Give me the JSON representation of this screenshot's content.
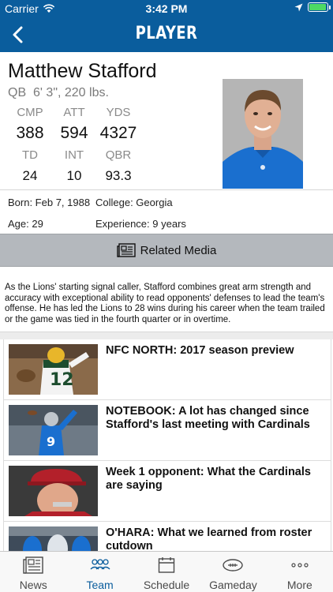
{
  "status": {
    "carrier": "Carrier",
    "time": "3:42 PM",
    "battery_level": 0.95
  },
  "nav": {
    "title": "PLAYER"
  },
  "player": {
    "name": "Matthew Stafford",
    "position": "QB",
    "physical": "6' 3\", 220 lbs.",
    "stats_row1": [
      {
        "label": "CMP",
        "value": "388"
      },
      {
        "label": "ATT",
        "value": "594"
      },
      {
        "label": "YDS",
        "value": "4327"
      }
    ],
    "stats_row2": [
      {
        "label": "TD",
        "value": "24"
      },
      {
        "label": "INT",
        "value": "10"
      },
      {
        "label": "QBR",
        "value": "93.3"
      }
    ],
    "born": "Born: Feb 7, 1988",
    "college": "College: Georgia",
    "age": "Age: 29",
    "experience": "Experience: 9 years"
  },
  "related_media": {
    "label": "Related Media"
  },
  "description": "As the Lions' starting signal caller, Stafford combines great arm strength and accuracy with exceptional ability to read opponents' defenses to lead the team's offense. He has led the Lions to 28 wins during his career when the team trailed or the game was tied in the fourth quarter or in overtime.",
  "news": [
    {
      "headline": "NFC NORTH: 2017 season preview"
    },
    {
      "headline": "NOTEBOOK: A lot has changed since Stafford's last meeting with Cardinals"
    },
    {
      "headline": "Week 1 opponent: What the Cardinals are saying"
    },
    {
      "headline": "O'HARA: What we learned from roster cutdown"
    }
  ],
  "tabs": [
    {
      "label": "News",
      "icon": "newspaper-icon"
    },
    {
      "label": "Team",
      "icon": "team-icon"
    },
    {
      "label": "Schedule",
      "icon": "calendar-icon"
    },
    {
      "label": "Gameday",
      "icon": "football-icon"
    },
    {
      "label": "More",
      "icon": "more-icon"
    }
  ],
  "colors": {
    "brand": "#0a5d9d",
    "active_tab": "#0a5d9d",
    "battery": "#4cd964"
  }
}
